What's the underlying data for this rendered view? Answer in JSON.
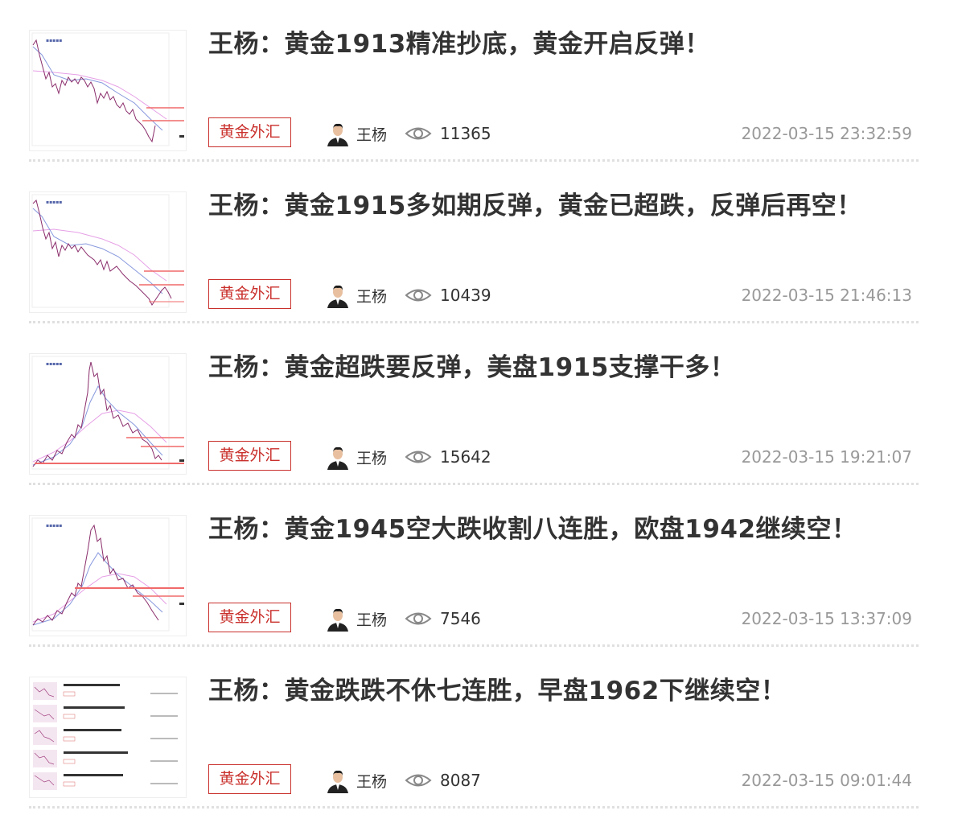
{
  "articles": [
    {
      "title": "王杨：黄金1913精准抄底，黄金开启反弹！",
      "tag": "黄金外汇",
      "author": "王杨",
      "views": "11365",
      "date": "2022-03-15 23:32:59"
    },
    {
      "title": "王杨：黄金1915多如期反弹，黄金已超跌，反弹后再空！",
      "tag": "黄金外汇",
      "author": "王杨",
      "views": "10439",
      "date": "2022-03-15 21:46:13"
    },
    {
      "title": "王杨：黄金超跌要反弹，美盘1915支撑干多！",
      "tag": "黄金外汇",
      "author": "王杨",
      "views": "15642",
      "date": "2022-03-15 19:21:07"
    },
    {
      "title": "王杨：黄金1945空大跌收割八连胜，欧盘1942继续空！",
      "tag": "黄金外汇",
      "author": "王杨",
      "views": "7546",
      "date": "2022-03-15 13:37:09"
    },
    {
      "title": "王杨：黄金跌跌不休七连胜，早盘1962下继续空！",
      "tag": "黄金外汇",
      "author": "王杨",
      "views": "8087",
      "date": "2022-03-15 09:01:44"
    }
  ],
  "colors": {
    "tag": "#c9302c",
    "date": "#999999",
    "title": "#333333"
  },
  "icons": {
    "avatar": "avatar-photo",
    "views": "eye-icon"
  }
}
